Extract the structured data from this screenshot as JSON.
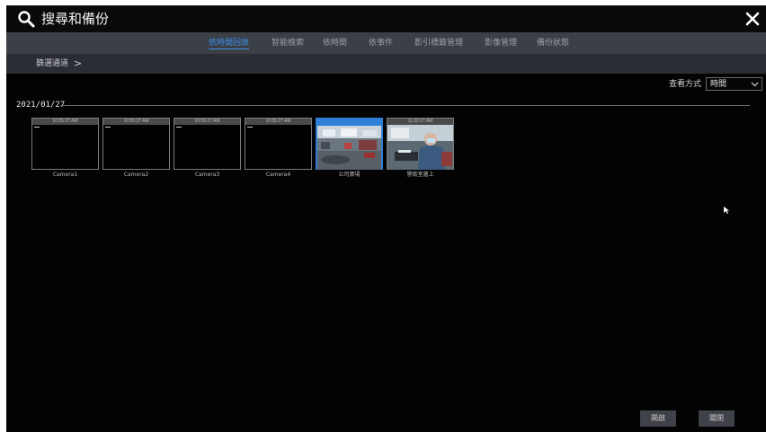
{
  "window": {
    "title": "搜尋和備份",
    "search_icon": "search-icon",
    "close_icon": "close-icon"
  },
  "tabs": [
    {
      "label": "依時間回放",
      "active": true
    },
    {
      "label": "智能檢索",
      "active": false
    },
    {
      "label": "依時間",
      "active": false
    },
    {
      "label": "依事件",
      "active": false
    },
    {
      "label": "影引標籤管理",
      "active": false
    },
    {
      "label": "影像管理",
      "active": false
    },
    {
      "label": "備份狀態",
      "active": false
    }
  ],
  "breadcrumb": {
    "label": "篩選通道",
    "arrow": ">"
  },
  "view_mode": {
    "label": "查看方式",
    "selected": "時間"
  },
  "group": {
    "date": "2021/01/27"
  },
  "thumbnails": [
    {
      "time": "10:55:27 AM",
      "name": "Camera1",
      "has_video": false,
      "selected": false
    },
    {
      "time": "10:55:27 AM",
      "name": "Camera2",
      "has_video": false,
      "selected": false
    },
    {
      "time": "10:55:27 AM",
      "name": "Camera3",
      "has_video": false,
      "selected": false
    },
    {
      "time": "10:55:27 AM",
      "name": "Camera4",
      "has_video": false,
      "selected": false
    },
    {
      "time": "",
      "name": "公司廣場",
      "has_video": true,
      "selected": true
    },
    {
      "time": "11:32:27 AM",
      "name": "警衛室牆上",
      "has_video": true,
      "selected": false
    }
  ],
  "buttons": {
    "open": "開啟",
    "close": "關閉"
  },
  "colors": {
    "accent": "#3d8ee8",
    "tabbar": "#3b3f46",
    "subbar": "#2a2d33",
    "background": "#030303"
  }
}
